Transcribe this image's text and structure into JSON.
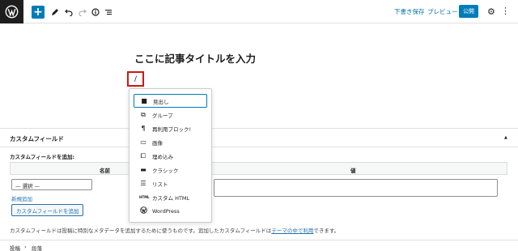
{
  "header": {
    "save_draft": "下書き保存",
    "preview": "プレビュー",
    "publish": "公開",
    "add_block": "+"
  },
  "editor": {
    "title_placeholder": "ここに記事タイトルを入力",
    "inserter_glyph": "/"
  },
  "inserter": {
    "blocks": [
      {
        "label": "見出し",
        "icon": "bookmark-icon",
        "glyph": "■"
      },
      {
        "label": "グループ",
        "icon": "group-icon",
        "glyph": "⧉"
      },
      {
        "label": "再利用ブロック!",
        "icon": "reusable-icon",
        "glyph": "¶"
      },
      {
        "label": "画像",
        "icon": "image-icon",
        "glyph": "▭"
      },
      {
        "label": "埋め込み",
        "icon": "embed-icon",
        "glyph": "⧠"
      },
      {
        "label": "クラシック",
        "icon": "keyboard-icon",
        "glyph": "▬"
      },
      {
        "label": "リスト",
        "icon": "list-icon",
        "glyph": "☰"
      },
      {
        "label": "カスタム HTML",
        "icon": "html-icon",
        "glyph": "HTML"
      },
      {
        "label": "WordPress",
        "icon": "wordpress-icon",
        "glyph": "W"
      }
    ]
  },
  "custom_fields": {
    "panel_title": "カスタムフィールド",
    "add_label": "カスタムフィールドを追加:",
    "col_name": "名前",
    "col_value": "値",
    "select_value": "— 選択 —",
    "new_link": "新規追加",
    "add_button": "カスタムフィールドを追加",
    "description_before": "カスタムフィールドは投稿に特別なメタデータを追加するために使うものです。追加したカスタムフィールドは",
    "description_link": "テーマの中で利用",
    "description_after": "できます。"
  },
  "breadcrumb": {
    "first": "投稿",
    "separator": "›",
    "second": "段落"
  },
  "colors": {
    "accent": "#007cba",
    "highlight_border": "#cc1818"
  }
}
